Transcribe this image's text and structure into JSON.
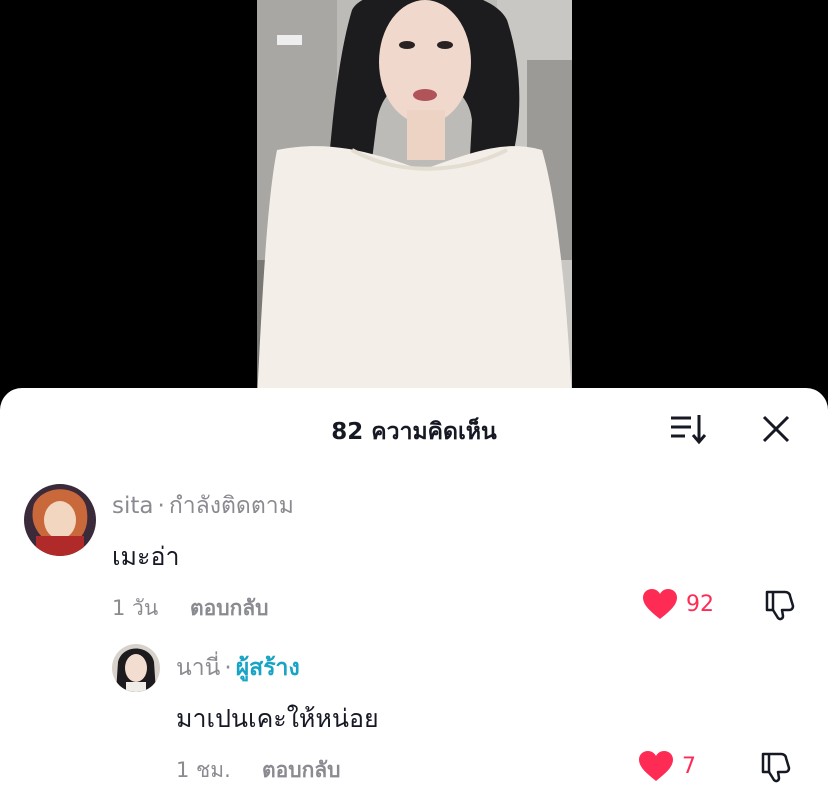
{
  "sheet": {
    "title": "82 ความคิดเห็น",
    "sort_icon": "sort-icon",
    "close_icon": "close-icon"
  },
  "comments": [
    {
      "username": "sita",
      "badge": "กำลังติดตาม",
      "text": "เมะอ่า",
      "time": "1 วัน",
      "reply_label": "ตอบกลับ",
      "likes": "92"
    },
    {
      "username": "นานี่",
      "badge": "ผู้สร้าง",
      "text": "มาเปนเคะให้หน่อย",
      "time": "1 ชม.",
      "reply_label": "ตอบกลับ",
      "likes": "7"
    }
  ],
  "colors": {
    "like": "#fe2c55",
    "creator_badge": "#18a4c4",
    "muted_text": "#8a8b91",
    "primary_text": "#161823"
  }
}
